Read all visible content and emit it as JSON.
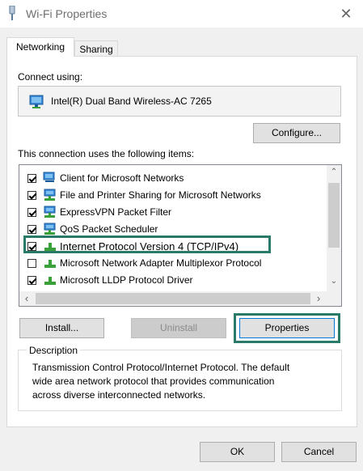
{
  "window": {
    "title": "Wi-Fi Properties"
  },
  "tabs": [
    {
      "label": "Networking"
    },
    {
      "label": "Sharing"
    }
  ],
  "connect_using": {
    "label": "Connect using:",
    "adapter": "Intel(R) Dual Band Wireless-AC 7265",
    "configure_label": "Configure..."
  },
  "items_label": "This connection uses the following items:",
  "items": [
    {
      "label": "Client for Microsoft Networks",
      "checked": true,
      "icon": "network-client-icon"
    },
    {
      "label": "File and Printer Sharing for Microsoft Networks",
      "checked": true,
      "icon": "network-service-icon"
    },
    {
      "label": "ExpressVPN Packet Filter",
      "checked": true,
      "icon": "network-service-icon"
    },
    {
      "label": "QoS Packet Scheduler",
      "checked": true,
      "icon": "network-service-icon"
    },
    {
      "label": "Internet Protocol Version 4 (TCP/IPv4)",
      "checked": true,
      "icon": "network-protocol-icon"
    },
    {
      "label": "Microsoft Network Adapter Multiplexor Protocol",
      "checked": false,
      "icon": "network-protocol-icon"
    },
    {
      "label": "Microsoft LLDP Protocol Driver",
      "checked": true,
      "icon": "network-protocol-icon"
    }
  ],
  "buttons": {
    "install": "Install...",
    "uninstall": "Uninstall",
    "properties": "Properties",
    "ok": "OK",
    "cancel": "Cancel"
  },
  "description": {
    "title": "Description",
    "lines": [
      "Transmission Control Protocol/Internet Protocol. The default",
      "wide area network protocol that provides communication",
      "across diverse interconnected networks."
    ]
  },
  "colors": {
    "highlight": "#2a7a6a",
    "client_bg": "#f0f0f0"
  }
}
